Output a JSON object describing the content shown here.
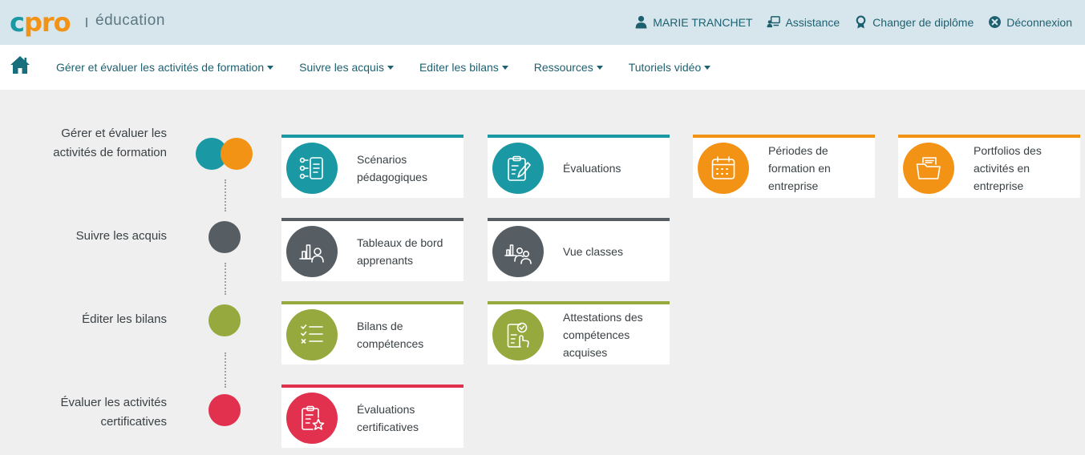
{
  "header": {
    "logo_c": "c",
    "logo_pro": "pro",
    "logo_suffix": "éducation",
    "user_name": "MARIE TRANCHET",
    "assistance": "Assistance",
    "change_diploma": "Changer de diplôme",
    "logout": "Déconnexion"
  },
  "nav": {
    "items": [
      {
        "label": "Gérer et évaluer les activités de formation"
      },
      {
        "label": "Suivre les acquis"
      },
      {
        "label": "Editer les bilans"
      },
      {
        "label": "Ressources"
      },
      {
        "label": "Tutoriels vidéo"
      }
    ]
  },
  "colors": {
    "teal": "#1a98a3",
    "orange": "#f39316",
    "gray": "#575e63",
    "olive": "#95a93e",
    "red": "#e2304f"
  },
  "rows": [
    {
      "label_line1": "Gérer et évaluer les",
      "label_line2": "activités de formation"
    },
    {
      "label_line1": "Suivre les acquis"
    },
    {
      "label_line1": "Éditer les bilans"
    },
    {
      "label_line1": "Évaluer les activités",
      "label_line2": "certificatives"
    }
  ],
  "cards": {
    "scenarios": {
      "line1": "Scénarios",
      "line2": "pédagogiques",
      "icon": "scenario-list-icon"
    },
    "evaluations": {
      "line1": "Évaluations",
      "icon": "clipboard-pen-icon"
    },
    "periodes": {
      "line1": "Périodes de",
      "line2": "formation en",
      "line3": "entreprise",
      "icon": "calendar-icon"
    },
    "portfolios": {
      "line1": "Portfolios des",
      "line2": "activités en",
      "line3": "entreprise",
      "icon": "folder-icon"
    },
    "tableaux": {
      "line1": "Tableaux de bord",
      "line2": "apprenants",
      "icon": "chart-person-icon"
    },
    "vue_classes": {
      "line1": "Vue classes",
      "icon": "chart-group-icon"
    },
    "bilans": {
      "line1": "Bilans de",
      "line2": "compétences",
      "icon": "checklist-icon"
    },
    "attestations": {
      "line1": "Attestations des",
      "line2": "compétences",
      "line3": "acquises",
      "icon": "attestation-icon"
    },
    "certificatives": {
      "line1": "Évaluations",
      "line2": "certificatives",
      "icon": "clipboard-star-icon"
    }
  }
}
